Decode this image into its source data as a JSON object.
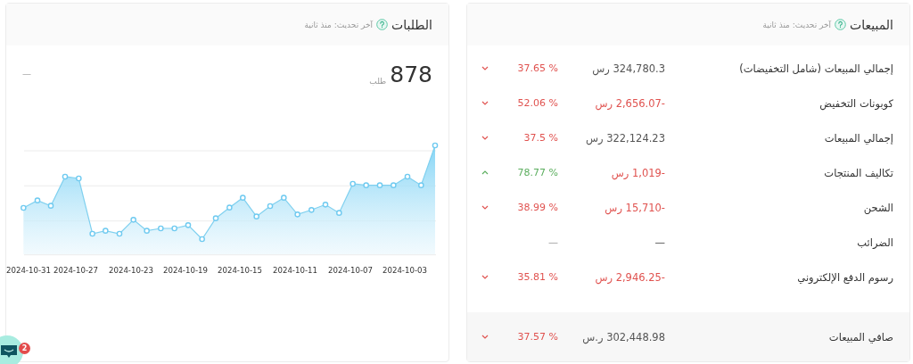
{
  "sales_card": {
    "title": "المبيعات",
    "updated": "آخر تحديث: منذ ثانية",
    "rows": [
      {
        "label": "إجمالي المبيعات (شامل التخفيضات)",
        "value": "324,780.3 رس",
        "negative": false,
        "change": "37.65 %",
        "rising": false,
        "falling": true
      },
      {
        "label": "كوبونات التخفيض",
        "value": "-2,656.07 رس",
        "negative": true,
        "change": "52.06 %",
        "rising": false,
        "falling": true
      },
      {
        "label": "إجمالي المبيعات",
        "value": "322,124.23 رس",
        "negative": false,
        "change": "37.5 %",
        "rising": false,
        "falling": true
      },
      {
        "label": "تكاليف المنتجات",
        "value": "-1,019 رس",
        "negative": true,
        "change": "78.77 %",
        "rising": true,
        "falling": false
      },
      {
        "label": "الشحن",
        "value": "-15,710 رس",
        "negative": true,
        "change": "38.99 %",
        "rising": false,
        "falling": true
      },
      {
        "label": "الضرائب",
        "value": "—",
        "negative": false,
        "change": "—",
        "rising": false,
        "falling": false
      },
      {
        "label": "رسوم الدفع الإلكتروني",
        "value": "-2,946.25 رس",
        "negative": true,
        "change": "35.81 %",
        "rising": false,
        "falling": true
      }
    ],
    "total": {
      "label": "صافي المبيعات",
      "value": "302,448.98 ر.س",
      "negative": false,
      "change": "37.57 %",
      "rising": false,
      "falling": true
    }
  },
  "orders_card": {
    "title": "الطلبات",
    "updated": "آخر تحديث: منذ ثانية",
    "count": "878",
    "unit": "طلب",
    "comparison": "—",
    "x_labels": [
      "2024-10-03",
      "2024-10-07",
      "2024-10-11",
      "2024-10-15",
      "2024-10-19",
      "2024-10-23",
      "2024-10-27",
      "2024-10-31"
    ]
  },
  "chat": {
    "badge": "2"
  }
}
